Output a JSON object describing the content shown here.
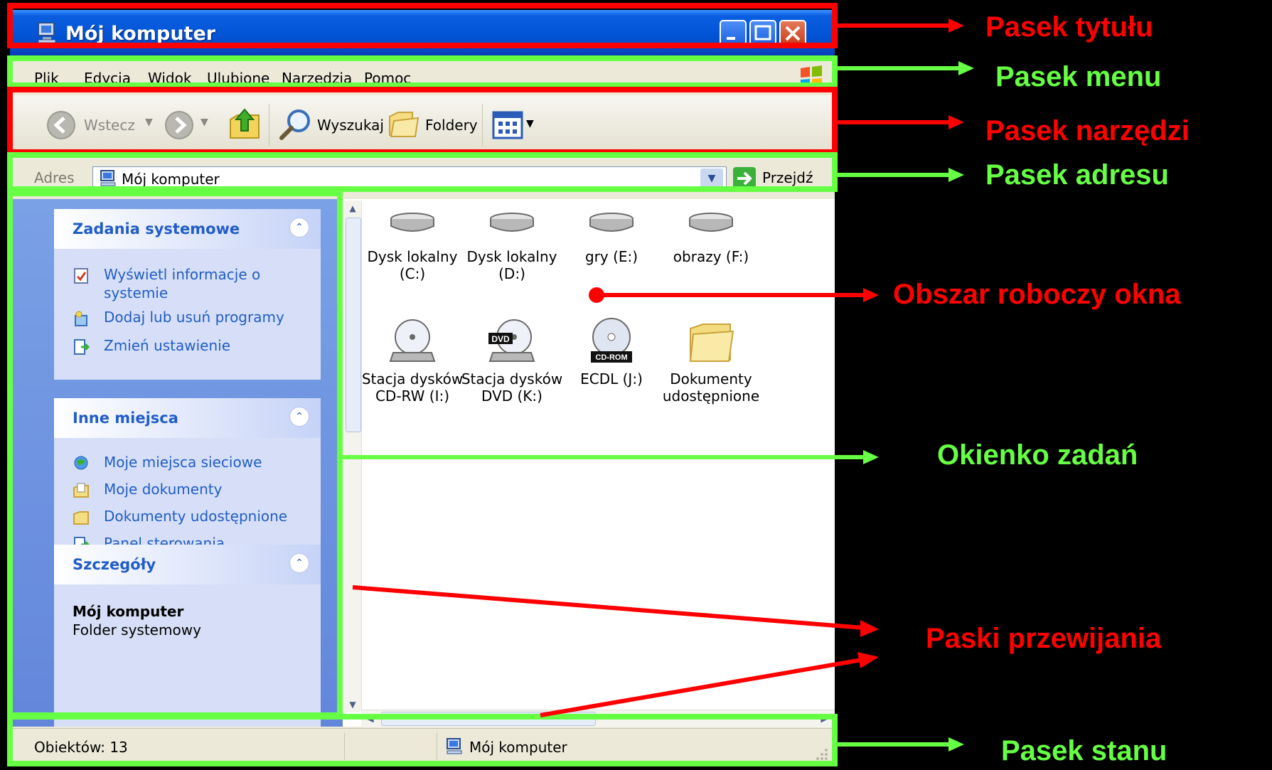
{
  "window": {
    "title": "Mój komputer"
  },
  "menu": {
    "items": [
      "Plik",
      "Edycja",
      "Widok",
      "Ulubione",
      "Narzędzia",
      "Pomoc"
    ]
  },
  "toolbar": {
    "back_label": "Wstecz",
    "search_label": "Wyszukaj",
    "folders_label": "Foldery"
  },
  "address": {
    "label": "Adres",
    "value": "Mój komputer",
    "go_label": "Przejdź"
  },
  "tasks": {
    "system": {
      "title": "Zadania systemowe",
      "items": [
        "Wyświetl informacje o",
        "systemie",
        "Dodaj lub usuń programy",
        "Zmień ustawienie"
      ]
    },
    "other": {
      "title": "Inne miejsca",
      "items": [
        "Moje miejsca sieciowe",
        "Moje dokumenty",
        "Dokumenty udostępnione",
        "Panel sterowania"
      ]
    },
    "details": {
      "title": "Szczegóły",
      "name": "Mój komputer",
      "type": "Folder systemowy"
    }
  },
  "files": [
    {
      "line1": "Dysk lokalny",
      "line2": "(C:)"
    },
    {
      "line1": "Dysk lokalny",
      "line2": "(D:)"
    },
    {
      "line1": "gry (E:)",
      "line2": ""
    },
    {
      "line1": "obrazy (F:)",
      "line2": ""
    },
    {
      "line1": "Stacja dysków",
      "line2": "CD-RW (I:)"
    },
    {
      "line1": "Stacja dysków",
      "line2": "DVD (K:)"
    },
    {
      "line1": "ECDL (J:)",
      "line2": ""
    },
    {
      "line1": "Dokumenty",
      "line2": "udostępnione"
    }
  ],
  "icon_labels": {
    "dvd": "DVD",
    "cdrom": "CD-ROM"
  },
  "status": {
    "count": "Obiektów: 13",
    "location": "Mój komputer"
  },
  "annotations": {
    "title_bar": "Pasek tytułu",
    "menu_bar": "Pasek menu",
    "toolbar": "Pasek narzędzi",
    "address_bar": "Pasek adresu",
    "work_area": "Obszar roboczy okna",
    "task_pane": "Okienko zadań",
    "scrollbars": "Paski przewijania",
    "status_bar": "Pasek stanu"
  },
  "colors": {
    "red": "#ff0000",
    "green": "#66ff44",
    "xp_blue": "#0255d6",
    "task_link": "#215dc6"
  }
}
